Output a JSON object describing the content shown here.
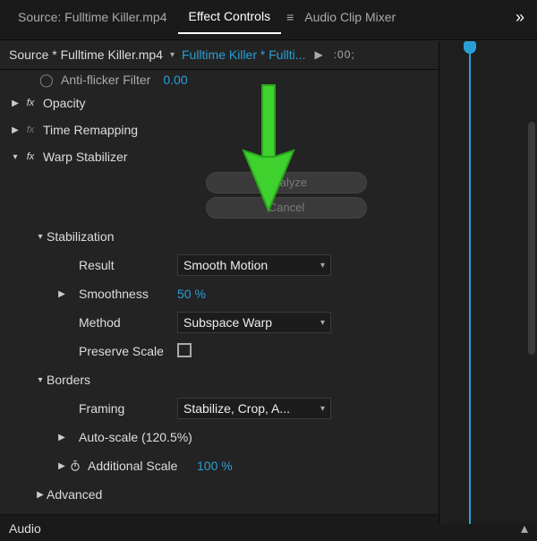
{
  "tabs": {
    "source": "Source: Fulltime Killer.mp4",
    "effect_controls": "Effect Controls",
    "audio_mixer": "Audio Clip Mixer"
  },
  "breadcrumb": {
    "source": "Source * Fulltime Killer.mp4",
    "clip": "Fulltime Killer * Fullti...",
    "timecode": ":00;"
  },
  "effects": {
    "anti_flicker": {
      "label": "Anti-flicker Filter",
      "value": "0.00"
    },
    "opacity": {
      "label": "Opacity"
    },
    "time_remapping": {
      "label": "Time Remapping"
    },
    "warp": {
      "label": "Warp Stabilizer",
      "analyze_btn": "Analyze",
      "cancel_btn": "Cancel",
      "stabilization": {
        "label": "Stabilization",
        "result": {
          "label": "Result",
          "value": "Smooth Motion"
        },
        "smoothness": {
          "label": "Smoothness",
          "value": "50 %"
        },
        "method": {
          "label": "Method",
          "value": "Subspace Warp"
        },
        "preserve_scale": {
          "label": "Preserve Scale"
        }
      },
      "borders": {
        "label": "Borders",
        "framing": {
          "label": "Framing",
          "value": "Stabilize, Crop, A..."
        },
        "auto_scale": {
          "label": "Auto-scale (120.5%)"
        },
        "additional_scale": {
          "label": "Additional Scale",
          "value": "100 %"
        }
      },
      "advanced": {
        "label": "Advanced"
      }
    }
  },
  "audio": {
    "label": "Audio"
  },
  "annotation": {
    "arrow_color": "#3fd12e"
  }
}
